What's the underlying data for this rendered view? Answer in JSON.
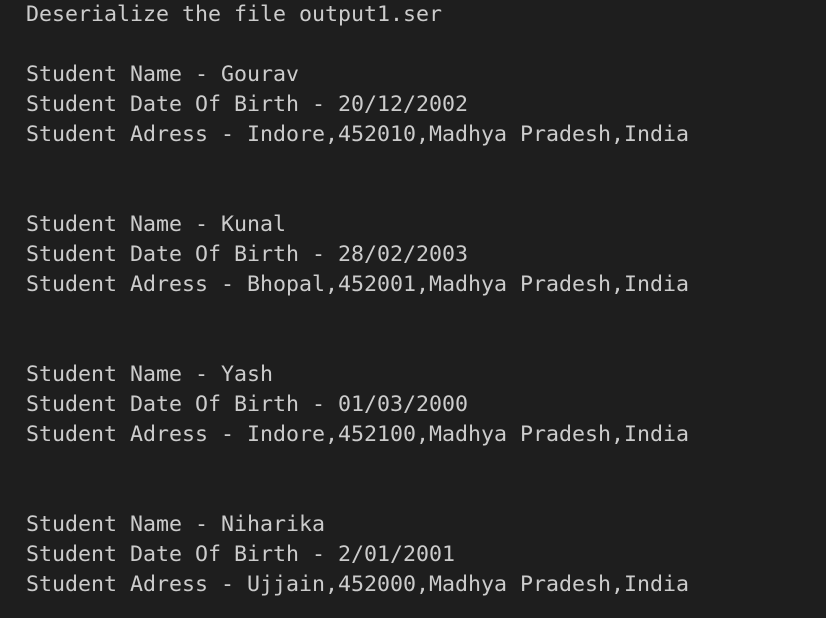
{
  "terminal": {
    "header": "Deserialize the file output1.ser",
    "records": [
      {
        "name_line": "Student Name - Gourav",
        "dob_line": "Student Date Of Birth - 20/12/2002",
        "address_line": "Student Adress - Indore,452010,Madhya Pradesh,India"
      },
      {
        "name_line": "Student Name - Kunal",
        "dob_line": "Student Date Of Birth - 28/02/2003",
        "address_line": "Student Adress - Bhopal,452001,Madhya Pradesh,India"
      },
      {
        "name_line": "Student Name - Yash",
        "dob_line": "Student Date Of Birth - 01/03/2000",
        "address_line": "Student Adress - Indore,452100,Madhya Pradesh,India"
      },
      {
        "name_line": "Student Name - Niharika",
        "dob_line": "Student Date Of Birth - 2/01/2001",
        "address_line": "Student Adress - Ujjain,452000,Madhya Pradesh,India"
      }
    ]
  }
}
